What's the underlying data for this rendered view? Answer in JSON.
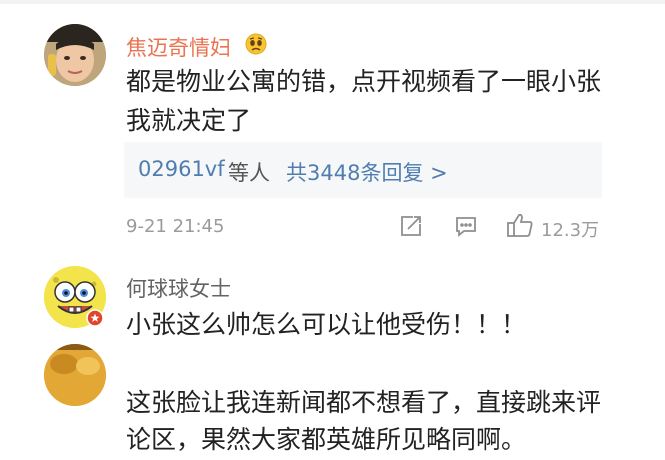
{
  "comments": [
    {
      "username": "焦迈奇情妇",
      "badge_icon": "sad-face-emoji-icon",
      "text_line1": "都是物业公寓的错，点开视频看了一眼小张",
      "text_line2": "我就决定了",
      "replies": {
        "user": "02961vf",
        "others": "等人",
        "count_text": "共3448条回复 >"
      },
      "time": "9-21 21:45",
      "likes": "12.3万"
    },
    {
      "username": "何球球女士",
      "text_line1": "小张这么帅怎么可以让他受伤！！！"
    },
    {
      "text_line1": "这张脸让我连新闻都不想看了，直接跳来评",
      "text_line2": "论区，果然大家都英雄所见略同啊。"
    }
  ],
  "colors": {
    "username_orange": "#eb7350",
    "username_gray": "#636363",
    "link_blue": "#507daf",
    "meta_gray": "#9b9b9b",
    "reply_bg": "#f6f7f9"
  }
}
